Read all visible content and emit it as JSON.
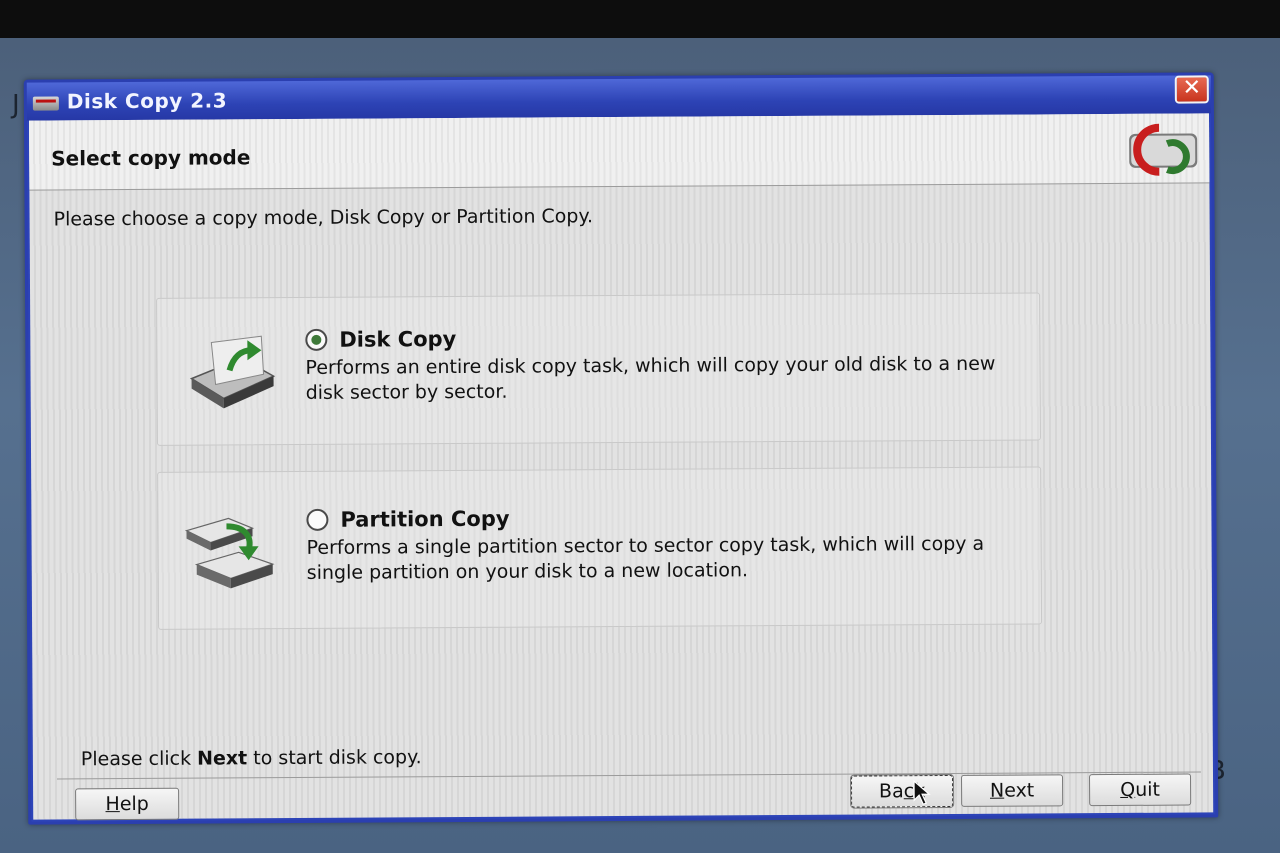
{
  "window": {
    "title": "Disk Copy 2.3",
    "close_label": "✕"
  },
  "header": {
    "title": "Select copy mode"
  },
  "instruction": "Please choose a copy mode, Disk Copy or Partition Copy.",
  "options": [
    {
      "label": "Disk Copy",
      "selected": true,
      "description": "Performs an entire disk copy task, which will copy your old disk to a new disk sector by sector.",
      "icon": "disk-copy-icon"
    },
    {
      "label": "Partition Copy",
      "selected": false,
      "description": "Performs a single partition sector to sector copy task, which will copy a single partition on your disk to a new location.",
      "icon": "partition-copy-icon"
    }
  ],
  "hint": {
    "before": "Please click ",
    "bold": "Next",
    "after": " to start disk copy."
  },
  "buttons": {
    "help": {
      "mnemonic": "H",
      "rest": "elp"
    },
    "back": {
      "pre": "Ba",
      "mnemonic": "c",
      "rest": "k"
    },
    "next": {
      "mnemonic": "N",
      "rest": "ext"
    },
    "quit": {
      "mnemonic": "Q",
      "rest": "uit"
    }
  },
  "colors": {
    "titlebar": "#2d43b5",
    "close": "#c8341e",
    "radio_checked": "#3f7a3a"
  }
}
